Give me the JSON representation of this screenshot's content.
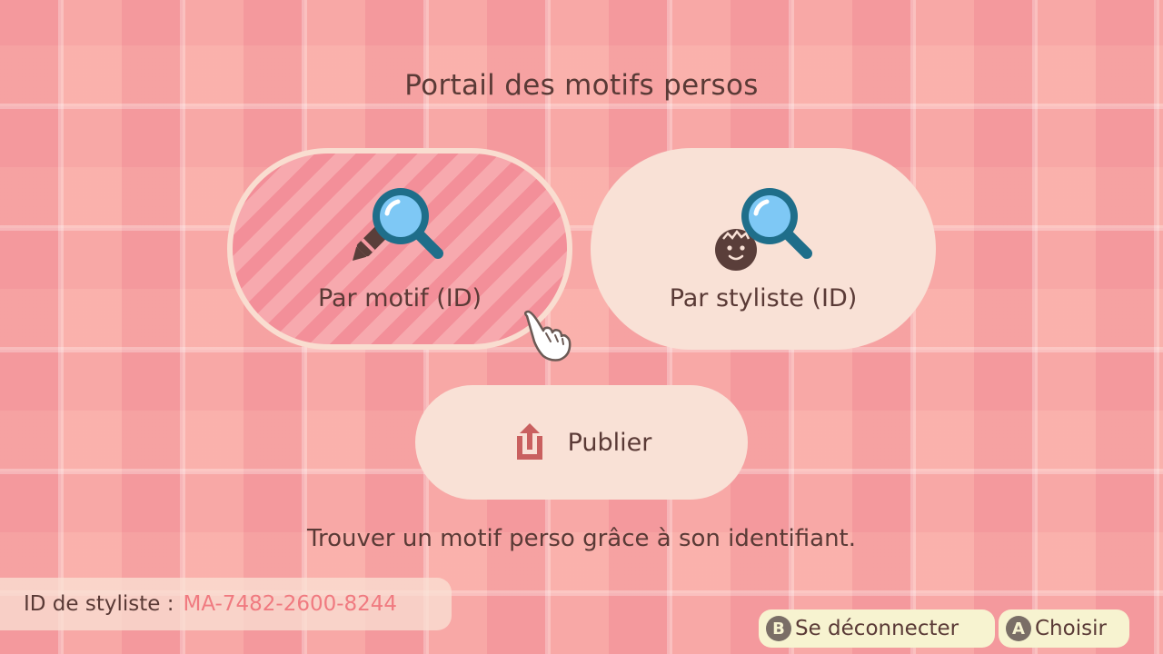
{
  "header": {
    "title": "Portail des motifs persos"
  },
  "options": {
    "by_pattern_label": "Par motif (ID)",
    "by_designer_label": "Par styliste (ID)",
    "publish_label": "Publier"
  },
  "description": "Trouver un motif perso grâce à son identifiant.",
  "designer_id": {
    "label": "ID de styliste :",
    "value": "MA-7482-2600-8244"
  },
  "controls": {
    "back_button_glyph": "B",
    "back_label": "Se déconnecter",
    "confirm_button_glyph": "A",
    "confirm_label": "Choisir"
  },
  "icons": {
    "by_pattern": [
      "pencil-icon",
      "magnifier-icon"
    ],
    "by_designer": [
      "face-icon",
      "magnifier-icon"
    ],
    "publish": "upload-icon",
    "cursor": "hand-pointer-icon"
  },
  "colors": {
    "accent_id": "#f07a80",
    "text": "#5a3a36",
    "pill_bg": "#f9e1d6",
    "selected_pill": "#f59aa3"
  }
}
